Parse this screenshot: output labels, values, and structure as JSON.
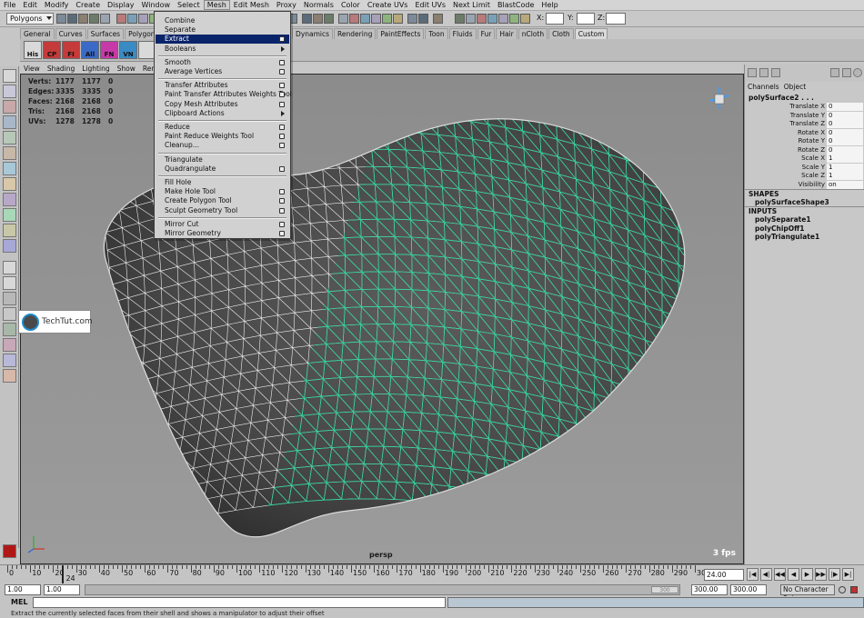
{
  "menubar": {
    "items": [
      "File",
      "Edit",
      "Modify",
      "Create",
      "Display",
      "Window",
      "Select",
      "Mesh",
      "Edit Mesh",
      "Proxy",
      "Normals",
      "Color",
      "Create UVs",
      "Edit UVs",
      "Next Limit",
      "BlastCode",
      "Help"
    ]
  },
  "status_line": {
    "mode": "Polygons",
    "x_label": "X:",
    "y_label": "Y:",
    "z_label": "Z:"
  },
  "shelf": {
    "tabs": [
      "General",
      "Curves",
      "Surfaces",
      "Polygons",
      "Subdivs",
      "Deformation",
      "Animation",
      "Dynamics",
      "Rendering",
      "PaintEffects",
      "Toon",
      "Fluids",
      "Fur",
      "Hair",
      "nCloth",
      "Cloth",
      "Custom"
    ],
    "buttons": [
      "His",
      "CP",
      "FI",
      "All",
      "FN",
      "VN",
      "",
      "",
      "",
      "mel",
      "",
      "Hshd"
    ]
  },
  "viewport": {
    "menu": [
      "View",
      "Shading",
      "Lighting",
      "Show",
      "Renderer",
      "Panels"
    ],
    "hud": [
      {
        "label": "Verts:",
        "a": "1177",
        "b": "1177",
        "c": "0"
      },
      {
        "label": "Edges:",
        "a": "3335",
        "b": "3335",
        "c": "0"
      },
      {
        "label": "Faces:",
        "a": "2168",
        "b": "2168",
        "c": "0"
      },
      {
        "label": "Tris:",
        "a": "2168",
        "b": "2168",
        "c": "0"
      },
      {
        "label": "UVs:",
        "a": "1278",
        "b": "1278",
        "c": "0"
      }
    ],
    "camera": "persp",
    "fps": "3 fps",
    "colors": {
      "wire_white": "#ffffff",
      "wire_green": "#2bd39a",
      "mesh_shade": "#4a4a4a",
      "background": "#959595"
    }
  },
  "mesh_menu": {
    "items": [
      {
        "label": "Combine",
        "option": false,
        "submenu": false,
        "selected": false
      },
      {
        "label": "Separate",
        "option": false,
        "submenu": false,
        "selected": false
      },
      {
        "label": "Extract",
        "option": true,
        "submenu": false,
        "selected": true
      },
      {
        "label": "Booleans",
        "option": false,
        "submenu": true,
        "selected": false
      },
      {
        "sep": true
      },
      {
        "label": "Smooth",
        "option": true,
        "submenu": false,
        "selected": false
      },
      {
        "label": "Average Vertices",
        "option": true,
        "submenu": false,
        "selected": false
      },
      {
        "sep": true
      },
      {
        "label": "Transfer Attributes",
        "option": true,
        "submenu": false,
        "selected": false
      },
      {
        "label": "Paint Transfer Attributes Weights Tool",
        "option": true,
        "submenu": false,
        "selected": false
      },
      {
        "label": "Copy Mesh Attributes",
        "option": true,
        "submenu": false,
        "selected": false
      },
      {
        "label": "Clipboard Actions",
        "option": false,
        "submenu": true,
        "selected": false
      },
      {
        "sep": true
      },
      {
        "label": "Reduce",
        "option": true,
        "submenu": false,
        "selected": false
      },
      {
        "label": "Paint Reduce Weights Tool",
        "option": true,
        "submenu": false,
        "selected": false
      },
      {
        "label": "Cleanup...",
        "option": true,
        "submenu": false,
        "selected": false
      },
      {
        "sep": true
      },
      {
        "label": "Triangulate",
        "option": false,
        "submenu": false,
        "selected": false
      },
      {
        "label": "Quadrangulate",
        "option": true,
        "submenu": false,
        "selected": false
      },
      {
        "sep": true
      },
      {
        "label": "Fill Hole",
        "option": false,
        "submenu": false,
        "selected": false
      },
      {
        "label": "Make Hole Tool",
        "option": true,
        "submenu": false,
        "selected": false
      },
      {
        "label": "Create Polygon Tool",
        "option": true,
        "submenu": false,
        "selected": false
      },
      {
        "label": "Sculpt Geometry Tool",
        "option": true,
        "submenu": false,
        "selected": false
      },
      {
        "sep": true
      },
      {
        "label": "Mirror Cut",
        "option": true,
        "submenu": false,
        "selected": false
      },
      {
        "label": "Mirror Geometry",
        "option": true,
        "submenu": false,
        "selected": false
      }
    ]
  },
  "channel_box": {
    "menu": [
      "Channels",
      "Object"
    ],
    "node": "polySurface2 . . .",
    "attributes": [
      {
        "name": "Translate X",
        "value": "0"
      },
      {
        "name": "Translate Y",
        "value": "0"
      },
      {
        "name": "Translate Z",
        "value": "0"
      },
      {
        "name": "Rotate X",
        "value": "0"
      },
      {
        "name": "Rotate Y",
        "value": "0"
      },
      {
        "name": "Rotate Z",
        "value": "0"
      },
      {
        "name": "Scale X",
        "value": "1"
      },
      {
        "name": "Scale Y",
        "value": "1"
      },
      {
        "name": "Scale Z",
        "value": "1"
      },
      {
        "name": "Visibility",
        "value": "on"
      }
    ],
    "shapes_header": "SHAPES",
    "shapes": [
      "polySurfaceShape3"
    ],
    "inputs_header": "INPUTS",
    "inputs": [
      "polySeparate1",
      "polyChipOff1",
      "polyTriangulate1"
    ]
  },
  "watermark": {
    "text": "TechTut.com"
  },
  "time_slider": {
    "tick_labels": [
      "0",
      "10",
      "20",
      "30",
      "40",
      "50",
      "60",
      "70",
      "80",
      "90",
      "100",
      "110",
      "120",
      "130",
      "140",
      "150",
      "160",
      "170",
      "180",
      "190",
      "200",
      "210",
      "220",
      "230",
      "240",
      "250",
      "260",
      "270",
      "280",
      "290",
      "30"
    ],
    "current_frame": "24",
    "current_time": "24.00",
    "playback_buttons": [
      "|◀",
      "◀|",
      "◀◀",
      "◀",
      "▶",
      "▶▶",
      "|▶",
      "▶|"
    ]
  },
  "range_slider": {
    "start": "1.00",
    "start2": "1.00",
    "handle": "300",
    "end": "300.00",
    "end2": "300.00",
    "character_set": "No Character Set"
  },
  "command_line": {
    "label": "MEL"
  },
  "help_line": "Extract the currently selected faces from their shell and shows a manipulator to adjust their offset"
}
